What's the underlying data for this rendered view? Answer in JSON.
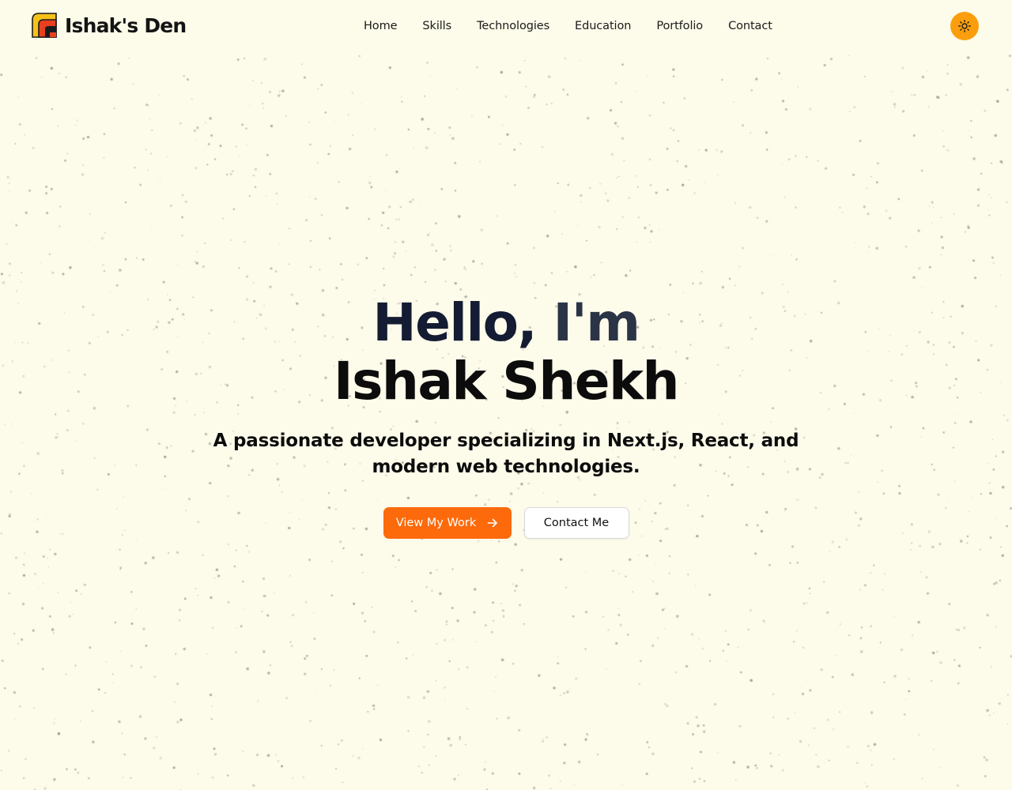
{
  "header": {
    "brand_name": "Ishak's Den",
    "logo_icon": "stacked-arch-logo-icon",
    "nav": [
      {
        "label": "Home"
      },
      {
        "label": "Skills"
      },
      {
        "label": "Technologies"
      },
      {
        "label": "Education"
      },
      {
        "label": "Portfolio"
      },
      {
        "label": "Contact"
      }
    ],
    "theme_toggle_icon": "sun-icon"
  },
  "hero": {
    "greeting": "Hello,",
    "intro": "I'm",
    "name": "Ishak Shekh",
    "tagline": "A passionate developer specializing in Next.js, React, and modern web technologies.",
    "primary_button": {
      "label": "View My Work",
      "icon": "arrow-right-icon"
    },
    "secondary_button": {
      "label": "Contact Me"
    }
  },
  "colors": {
    "background": "#fdfbea",
    "accent_orange": "#fd6a0b",
    "toggle_amber": "#fb9e0e",
    "logo_yellow": "#f6c21a",
    "logo_red": "#e8401f",
    "heading_dark": "#0c0c0c",
    "heading_slate": "#2b3446",
    "speckle": "#8a8a80"
  }
}
